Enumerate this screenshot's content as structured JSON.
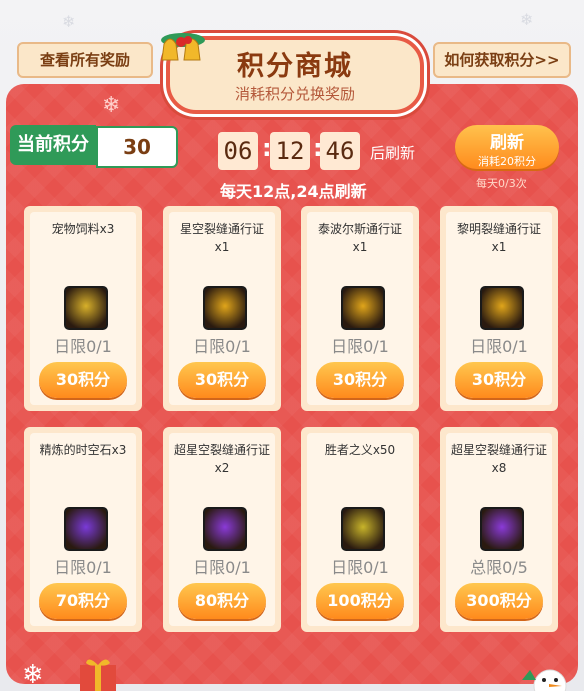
{
  "header": {
    "view_all_rewards": "查看所有奖励",
    "how_to_get_points": "如何获取积分>>",
    "title": "积分商城",
    "subtitle": "消耗积分兑换奖励"
  },
  "points": {
    "label": "当前积分",
    "value": "30"
  },
  "timer": {
    "hours": "06",
    "minutes": "12",
    "seconds": "46",
    "suffix": "后刷新",
    "note": "每天12点,24点刷新"
  },
  "refresh": {
    "label": "刷新",
    "cost": "消耗20积分",
    "count": "每天0/3次"
  },
  "items": [
    {
      "name": "宠物饲料x3",
      "limit": "日限0/1",
      "price": "30积分",
      "icon": "pet-food-icon",
      "color": "#d8b02a"
    },
    {
      "name": "星空裂缝通行证x1",
      "limit": "日限0/1",
      "price": "30积分",
      "icon": "free-pass-icon",
      "color": "#e0a51a"
    },
    {
      "name": "泰波尔斯通行证x1",
      "limit": "日限0/1",
      "price": "30积分",
      "icon": "free-pass-icon",
      "color": "#e0a51a"
    },
    {
      "name": "黎明裂缝通行证x1",
      "limit": "日限0/1",
      "price": "30积分",
      "icon": "free-pass-icon",
      "color": "#e0a51a"
    },
    {
      "name": "精炼的时空石x3",
      "limit": "日限0/1",
      "price": "70积分",
      "icon": "time-stone-icon",
      "color": "#7a3ad8"
    },
    {
      "name": "超星空裂缝通行证x2",
      "limit": "日限0/1",
      "price": "80积分",
      "icon": "free-pass-icon",
      "color": "#8a3ad8"
    },
    {
      "name": "胜者之义x50",
      "limit": "日限0/1",
      "price": "100积分",
      "icon": "fist-icon",
      "color": "#c8b42a"
    },
    {
      "name": "超星空裂缝通行证x8",
      "limit": "总限0/5",
      "price": "300积分",
      "icon": "free-pass-icon",
      "color": "#8a3ad8"
    }
  ]
}
